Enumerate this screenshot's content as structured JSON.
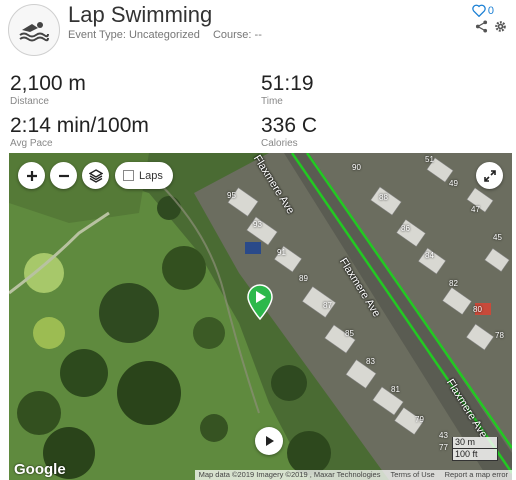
{
  "activity": {
    "icon": "swimming-icon",
    "title": "Lap Swimming",
    "event_type": "Event Type: Uncategorized",
    "course": "Course: --",
    "likes": "0"
  },
  "stats": [
    {
      "value": "2,100 m",
      "label": "Distance"
    },
    {
      "value": "51:19",
      "label": "Time"
    },
    {
      "value": "2:14 min/100m",
      "label": "Avg Pace"
    },
    {
      "value": "336 C",
      "label": "Calories"
    }
  ],
  "map": {
    "laps_label": "Laps",
    "street_labels": [
      "Flaxmere Ave",
      "Flaxmere Ave",
      "Flaxmere Ave"
    ],
    "house_numbers": [
      "95",
      "93",
      "91",
      "89",
      "87",
      "85",
      "83",
      "81",
      "79",
      "77",
      "90",
      "88",
      "86",
      "84",
      "82",
      "80",
      "78",
      "51",
      "49",
      "47",
      "45",
      "43"
    ],
    "scale_metric": "30 m",
    "scale_imperial": "100 ft",
    "google": "Google",
    "attribution": {
      "map_data": "Map data ©2019 Imagery ©2019 , Maxar Technologies",
      "terms": "Terms of Use",
      "report": "Report a map error"
    }
  }
}
